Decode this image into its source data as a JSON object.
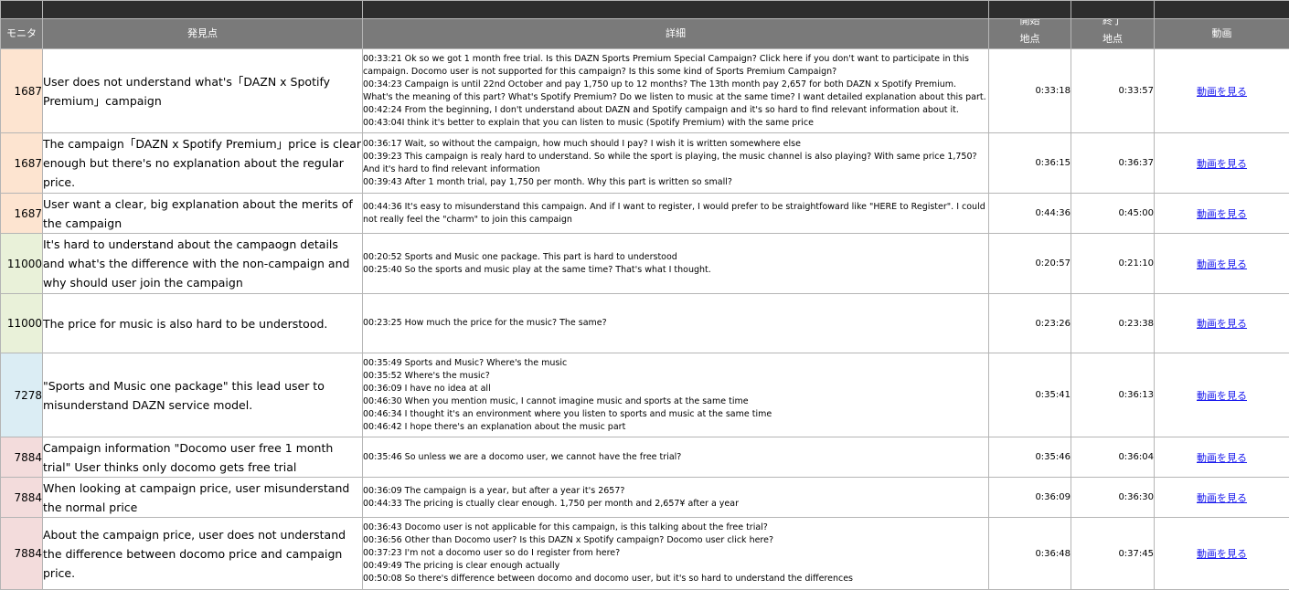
{
  "colors": {
    "top_strip": "#2d2d2d",
    "header_bg": "#7a7a7a",
    "monitor_1687": "#fde4d0",
    "monitor_11000": "#e9f1d9",
    "monitor_7278": "#dbedf4",
    "monitor_7884": "#f3dcdc",
    "link": "#1a1aee"
  },
  "header": {
    "monitor": "モニタ",
    "finding": "発見点",
    "detail": "詳細",
    "start_line1": "開始",
    "start_line2": "地点",
    "end_line1": "終了",
    "end_line2": "地点",
    "video": "動画"
  },
  "rows": [
    {
      "monitor": "1687",
      "monitor_color": "#fde4d0",
      "finding": "User does not understand what's「DAZN x Spotify Premium」campaign",
      "details": [
        "00:33:21 Ok so we got 1 month free trial. Is this DAZN Sports Premium Special Campaign? Click here if you don't want to participate in this campaign. Docomo user is not supported for this campaign? Is this some kind of Sports Premium Campaign?",
        "00:34:23 Campaign is until 22nd October and pay 1,750 up to 12 months? The 13th month pay 2,657 for both DAZN x Spotify Premium. What's the meaning of this part? What's Spotify Premium? Do we listen to music at the same time? I want detailed explanation about this part.",
        "00:42:24 From the beginning, I don't understand about DAZN and Spotify campaign and it's so hard to find relevant information about it.",
        "00:43:04I think it's better to explain that you can listen to music (Spotify Premium) with the same price"
      ],
      "start": "0:33:18",
      "end": "0:33:57",
      "video": "動画を見る",
      "height": 92
    },
    {
      "monitor": "1687",
      "monitor_color": "#fde4d0",
      "finding": "The campaign「DAZN x Spotify Premium」price is clear enough but there's no explanation about the regular price.",
      "details": [
        "00:36:17 Wait, so without the campaign, how much should I pay? I wish it is written somewhere else",
        "00:39:23 This campaign is realy hard to understand. So while the sport is playing, the music channel is also playing? With same price 1,750? And it's hard to find relevant information",
        "00:39:43 After 1 month trial, pay 1,750 per month. Why this part is written so small?"
      ],
      "start": "0:36:15",
      "end": "0:36:37",
      "video": "動画を見る",
      "height": 66
    },
    {
      "monitor": "1687",
      "monitor_color": "#fde4d0",
      "finding": "User want a clear, big explanation about the merits of the campaign",
      "details": [
        "00:44:36 It's easy to misunderstand this campaign. And if I want to register, I would prefer to be straightfoward like \"HERE to Register\". I could not really feel the \"charm\" to join this campaign"
      ],
      "start": "0:44:36",
      "end": "0:45:00",
      "video": "動画を見る",
      "height": 44
    },
    {
      "monitor": "11000",
      "monitor_color": "#e9f1d9",
      "finding": "It's hard to understand about the campaogn details and what's the difference with the non-campaign and why should user join the campaign",
      "details": [
        "00:20:52 Sports and Music one package. This part is hard to understood",
        "00:25:40 So the sports and music play at the same time? That's what I thought."
      ],
      "start": "0:20:57",
      "end": "0:21:10",
      "video": "動画を見る",
      "height": 66
    },
    {
      "monitor": "11000",
      "monitor_color": "#e9f1d9",
      "finding": "The price for music is also hard to be understood.",
      "details": [
        "00:23:25 How much the price for the music? The same?"
      ],
      "start": "0:23:26",
      "end": "0:23:38",
      "video": "動画を見る",
      "height": 65
    },
    {
      "monitor": "7278",
      "monitor_color": "#dbedf4",
      "finding": "\"Sports and Music one package\" this lead user to misunderstand DAZN service model.",
      "details": [
        "00:35:49 Sports and Music? Where's the music",
        "00:35:52 Where's the music?",
        "00:36:09 I have no idea at all",
        "00:46:30 When you mention music, I cannot imagine music and sports at the same time",
        "00:46:34 I thought it's an environment where you listen to sports and music at the same time",
        "00:46:42 I hope there's an explanation about the music part"
      ],
      "start": "0:35:41",
      "end": "0:36:13",
      "video": "動画を見る",
      "height": 92
    },
    {
      "monitor": "7884",
      "monitor_color": "#f3dcdc",
      "finding": "Campaign information \"Docomo user free 1 month trial\" User thinks only docomo gets free trial",
      "details": [
        "00:35:46 So unless we are a docomo user, we cannot have the free trial?"
      ],
      "start": "0:35:46",
      "end": "0:36:04",
      "video": "動画を見る",
      "height": 44
    },
    {
      "monitor": "7884",
      "monitor_color": "#f3dcdc",
      "finding": "When looking at campaign price, user misunderstand the normal price",
      "details": [
        "00:36:09 The campaign is a year, but after a year it's 2657?",
        "00:44:33 The pricing is ctually clear enough. 1,750 per month and 2,657¥ after a year"
      ],
      "start": "0:36:09",
      "end": "0:36:30",
      "video": "動画を見る",
      "height": 44
    },
    {
      "monitor": "7884",
      "monitor_color": "#f3dcdc",
      "finding": "About the campaign price, user does not understand the difference between docomo price and campaign price.",
      "details": [
        "00:36:43 Docomo user is not applicable for this campaign, is this talking about the free trial?",
        "00:36:56  Other than Docomo user? Is this DAZN x Spotify campaign? Docomo user click here?",
        "00:37:23 I'm not a docomo user so do I register from here?",
        "00:49:49 The pricing is clear enough actually",
        "00:50:08 So there's difference between docomo and docomo user, but it's so hard to understand the differences"
      ],
      "start": "0:36:48",
      "end": "0:37:45",
      "video": "動画を見る",
      "height": 79
    }
  ]
}
